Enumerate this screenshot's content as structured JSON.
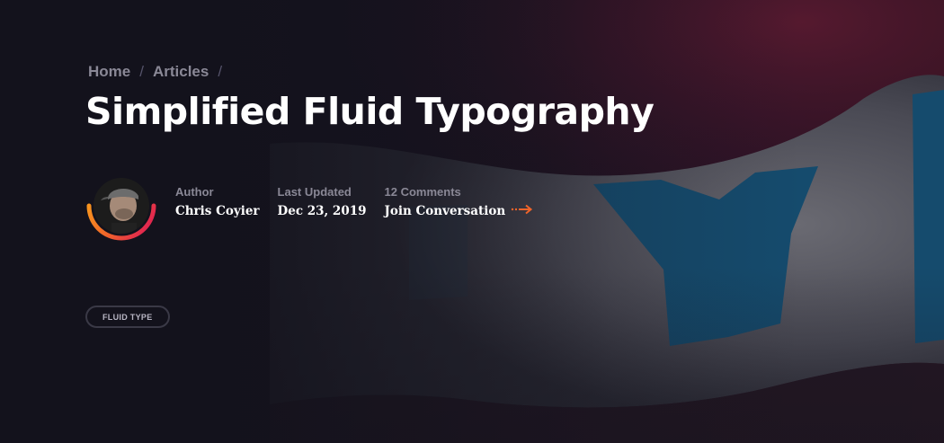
{
  "breadcrumb": {
    "items": [
      "Home",
      "Articles"
    ],
    "separator": "/"
  },
  "article": {
    "title": "Simplified Fluid Typography"
  },
  "meta": {
    "author_label": "Author",
    "author_name": "Chris Coyier",
    "updated_label": "Last Updated",
    "updated_date": "Dec 23, 2019",
    "comments_label": "12 Comments",
    "comments_link": "Join Conversation"
  },
  "tags": [
    "FLUID TYPE"
  ],
  "colors": {
    "background": "#13121c",
    "accent_orange": "#f0642a",
    "accent_red": "#e2284e",
    "muted_text": "#8a8896",
    "banner_blue": "#154b6d"
  },
  "icons": {
    "comments_arrow": "arrow-right-icon"
  }
}
